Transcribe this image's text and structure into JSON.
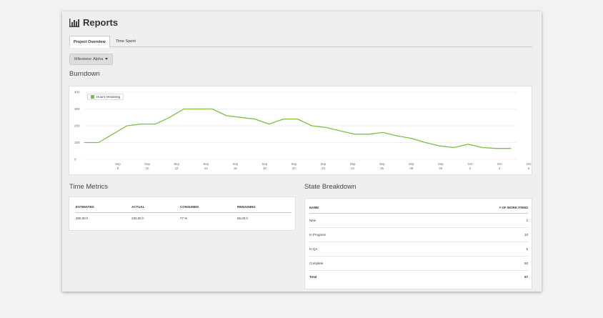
{
  "header": {
    "title": "Reports",
    "icon": "bar-chart-icon"
  },
  "tabs": [
    {
      "label": "Project Overview",
      "active": true
    },
    {
      "label": "Time Spent",
      "active": false
    }
  ],
  "milestone": {
    "label": "Milestone: Alpha"
  },
  "burndown": {
    "title": "Burndown",
    "legend": "Hours remaining"
  },
  "chart_data": {
    "type": "line",
    "title": "Burndown",
    "legend_placement": "top-left",
    "grid": true,
    "series_color": "#7ac142",
    "ylim": [
      0,
      400
    ],
    "y_ticks": [
      "400",
      "300",
      "200",
      "100",
      "0"
    ],
    "x_ticks": [
      [
        "Sep",
        "8"
      ],
      [
        "Sep",
        "10"
      ],
      [
        "Sep",
        "12"
      ],
      [
        "Sep",
        "14"
      ],
      [
        "Sep",
        "16"
      ],
      [
        "Sep",
        "18"
      ],
      [
        "Sep",
        "20"
      ],
      [
        "Sep",
        "22"
      ],
      [
        "Sep",
        "24"
      ],
      [
        "Sep",
        "26"
      ],
      [
        "Sep",
        "28"
      ],
      [
        "Sep",
        "30"
      ],
      [
        "Oct",
        "2"
      ],
      [
        "Oct",
        "4"
      ],
      [
        "Oct",
        "6"
      ]
    ],
    "x": [
      "Sep 7",
      "Sep 8",
      "Sep 9",
      "Sep 10",
      "Sep 11",
      "Sep 12",
      "Sep 13",
      "Sep 14",
      "Sep 15",
      "Sep 16",
      "Sep 17",
      "Sep 18",
      "Sep 19",
      "Sep 20",
      "Sep 21",
      "Sep 22",
      "Sep 23",
      "Sep 24",
      "Sep 25",
      "Sep 26",
      "Sep 27",
      "Sep 28",
      "Sep 29",
      "Sep 30",
      "Oct 1",
      "Oct 2",
      "Oct 3",
      "Oct 4",
      "Oct 5",
      "Oct 6"
    ],
    "series": [
      {
        "name": "Hours remaining",
        "values": [
          100,
          100,
          150,
          200,
          210,
          210,
          250,
          300,
          300,
          300,
          260,
          250,
          240,
          210,
          240,
          240,
          200,
          190,
          170,
          150,
          150,
          160,
          140,
          125,
          100,
          80,
          70,
          90,
          70,
          65,
          65
        ]
      }
    ]
  },
  "time_metrics": {
    "title": "Time Metrics",
    "headers": [
      "ESTIMATED",
      "ACTUAL",
      "CONSUMED",
      "REMAINING"
    ],
    "values": [
      "300.00 h",
      "230.00 h",
      "77 %",
      "65.00 h"
    ]
  },
  "state_breakdown": {
    "title": "State Breakdown",
    "headers": [
      "NAME",
      "# OF WORK ITEMS"
    ],
    "rows": [
      {
        "name": "New",
        "count": "2"
      },
      {
        "name": "In Progress",
        "count": "10"
      },
      {
        "name": "In QA",
        "count": "5"
      },
      {
        "name": "Complete",
        "count": "50"
      }
    ],
    "total": {
      "name": "Total",
      "count": "67"
    }
  }
}
